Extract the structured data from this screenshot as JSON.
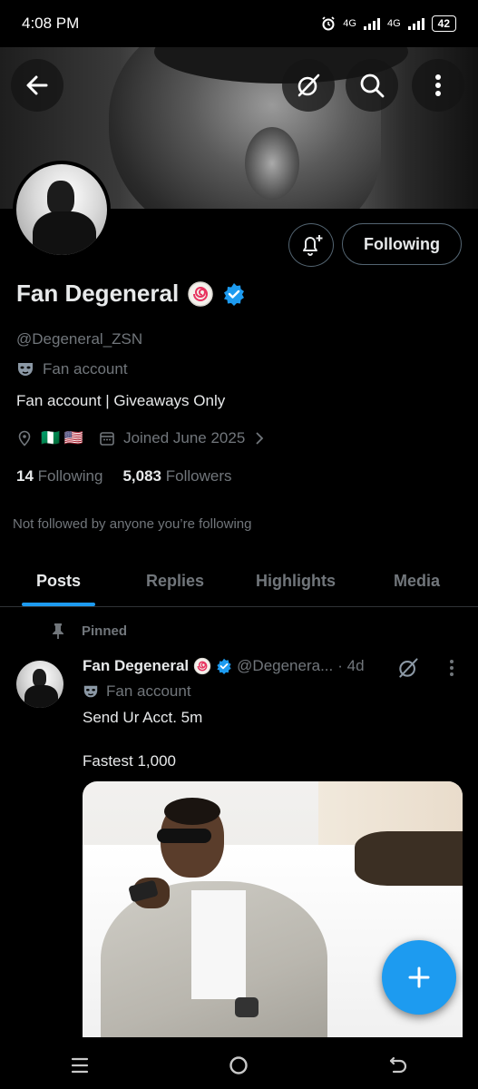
{
  "status_bar": {
    "time": "4:08 PM",
    "network1": "4G",
    "network2": "4G",
    "battery": "42"
  },
  "profile": {
    "display_name": "Fan Degeneral",
    "handle": "@Degeneral_ZSN",
    "label": "Fan account",
    "bio": "Fan account | Giveaways Only",
    "flags": "🇳🇬 🇺🇸",
    "joined": "Joined June 2025",
    "following_count": "14",
    "following_label": "Following",
    "followers_count": "5,083",
    "followers_label": "Followers",
    "not_followed_text": "Not followed by anyone you’re following",
    "follow_button": "Following"
  },
  "tabs": [
    "Posts",
    "Replies",
    "Highlights",
    "Media"
  ],
  "active_tab": "Posts",
  "tweet": {
    "pinned_label": "Pinned",
    "name": "Fan Degeneral",
    "handle": "@Degenera...",
    "time": "· 4d",
    "label": "Fan account",
    "text_line1": "Send Ur Acct. 5m",
    "text_line2": "Fastest 1,000"
  },
  "colors": {
    "accent": "#1d9bf0",
    "background": "#000000",
    "text_primary": "#e7e9ea",
    "text_secondary": "#71767b",
    "border": "#536471"
  },
  "icons": {
    "back": "arrow-left-icon",
    "grok": "grok-slash-icon",
    "search": "search-icon",
    "more": "more-vertical-icon",
    "notify": "bell-plus-icon",
    "affiliate_badge": "swirl-badge-icon",
    "verified": "verified-badge-icon",
    "label": "mask-icon",
    "location": "location-pin-icon",
    "calendar": "calendar-icon",
    "pin": "pin-icon",
    "compose": "plus-icon",
    "nav_recents": "menu-lines-icon",
    "nav_home": "circle-home-icon",
    "nav_back": "return-arrow-icon"
  }
}
